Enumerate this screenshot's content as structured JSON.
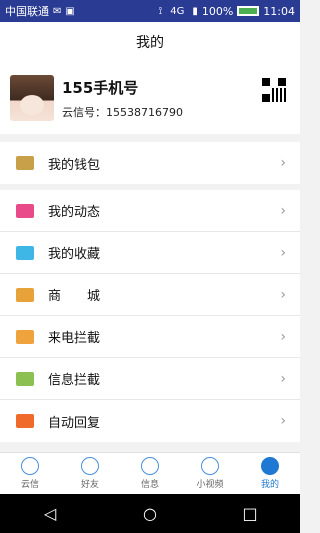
{
  "statusbar": {
    "carrier": "中国联通",
    "battery": "100%",
    "time": "11:04",
    "network": "4G"
  },
  "title": "我的",
  "profile": {
    "name": "155手机号",
    "id_label": "云信号：15538716790"
  },
  "menu_group1": [
    {
      "label": "我的钱包",
      "icon": "wallet-icon",
      "color": "#c8a04a"
    }
  ],
  "menu_group2": [
    {
      "label": "我的动态",
      "icon": "moments-icon",
      "color": "#e94b8a"
    },
    {
      "label": "我的收藏",
      "icon": "favorites-icon",
      "color": "#3fb7e6"
    },
    {
      "label": "商　　城",
      "icon": "shop-icon",
      "color": "#e8a23a"
    },
    {
      "label": "来电拦截",
      "icon": "call-block-icon",
      "color": "#f0a23c"
    },
    {
      "label": "信息拦截",
      "icon": "message-block-icon",
      "color": "#8cc152"
    },
    {
      "label": "自动回复",
      "icon": "auto-reply-icon",
      "color": "#f06b2b"
    }
  ],
  "tabs": [
    {
      "label": "云信",
      "icon": "chat-icon"
    },
    {
      "label": "好友",
      "icon": "friends-icon"
    },
    {
      "label": "信息",
      "icon": "message-icon"
    },
    {
      "label": "小视频",
      "icon": "video-icon"
    },
    {
      "label": "我的",
      "icon": "me-icon",
      "active": true
    }
  ],
  "colors": {
    "statusbar": "#2a3b93",
    "accent": "#1f78d1"
  }
}
